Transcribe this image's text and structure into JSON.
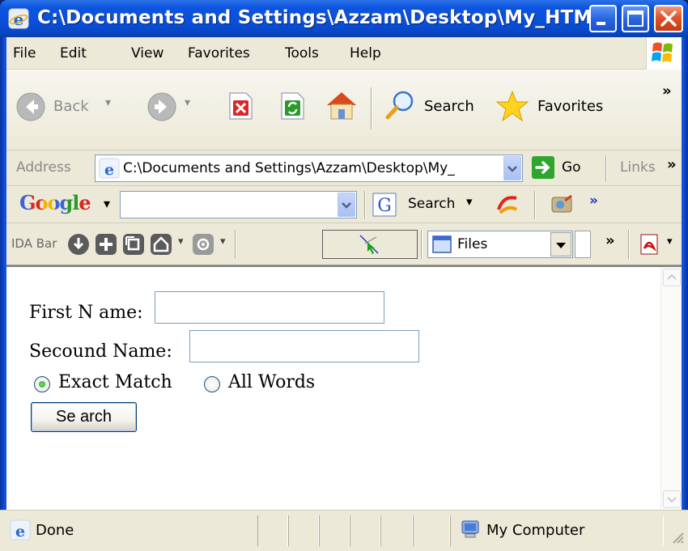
{
  "window": {
    "title": "C:\\Documents and Settings\\Azzam\\Desktop\\My_HTM..."
  },
  "menu": {
    "items": [
      "File",
      "Edit",
      "View",
      "Favorites",
      "Tools",
      "Help"
    ]
  },
  "toolbar": {
    "back_label": "Back",
    "search_label": "Search",
    "favorites_label": "Favorites",
    "chevron": "»"
  },
  "address": {
    "label": "Address",
    "value": "C:\\Documents and Settings\\Azzam\\Desktop\\My_",
    "go_label": "Go",
    "links_label": "Links",
    "chevron": "»"
  },
  "google_bar": {
    "logo": "Google",
    "search_label": "Search",
    "chevron": "»"
  },
  "ida_bar": {
    "label": "IDA Bar",
    "files_label": "Files",
    "chevron": "»"
  },
  "form": {
    "first_name_label": "First N ame:",
    "first_name_value": "",
    "second_name_label": "Secound Name:",
    "second_name_value": "",
    "radio_exact_label": "Exact Match",
    "radio_all_label": "All Words",
    "selected_radio": "exact",
    "search_button": "Se arch"
  },
  "status": {
    "text": "Done",
    "zone": "My Computer"
  },
  "colors": {
    "title_blue": "#0a4fd8",
    "chrome": "#ece9d8",
    "close_red": "#e0542c"
  }
}
